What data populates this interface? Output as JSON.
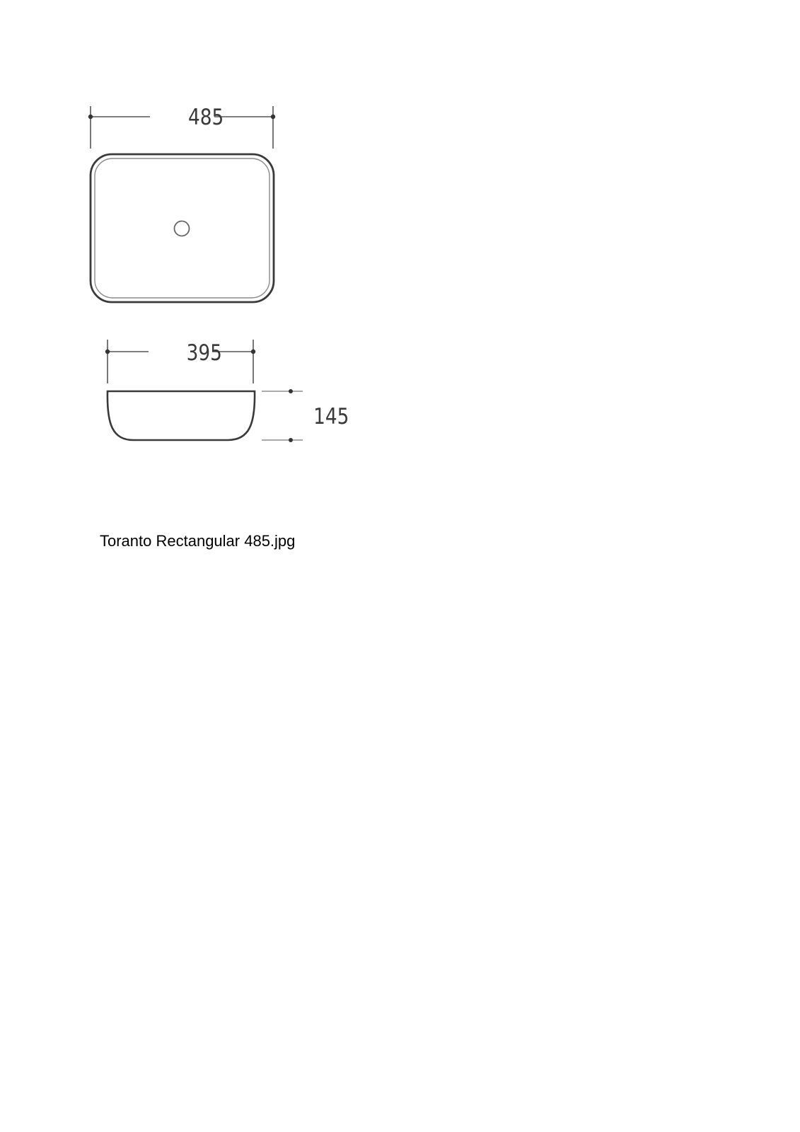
{
  "drawing": {
    "top_view": {
      "width_label": "485"
    },
    "side_view": {
      "base_width_label": "395",
      "height_label": "145"
    }
  },
  "caption": "Toranto Rectangular 485.jpg",
  "colors": {
    "line": "#3a3a3a",
    "dimension_line": "#555555",
    "background": "#ffffff"
  }
}
